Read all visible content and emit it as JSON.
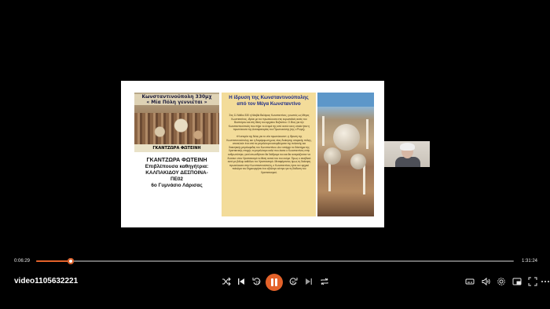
{
  "slide": {
    "thumbnail": {
      "title_line1": "Κωνσταντινούπολη 330μχ",
      "title_line2": "« Μία Πόλη γεννιέται »",
      "caption": "ΓΚΑΝΤΖΩΡΑ ΦΩΤΕΙΝΗ"
    },
    "author": {
      "name": "ΓΚΑΝΤΖΩΡΑ ΦΩΤΕΙΝΗ",
      "supervisor_label": "Επιβλέπουσα καθηγήτρια:",
      "supervisor_name": "ΚΑΛΠΑΚΙΔΟΥ ΔΕΣΠΟΙΝΑ-",
      "supervisor_code": "ΠΕ02",
      "school": "6ο Γυμνάσιο Λάρισας"
    },
    "article": {
      "title": "Η ίδρυση της Κωνσταντινούπολης από τον Μέγα Κωνσταντίνο",
      "paragraph1": "Στις 11 Μαΐου 330 η Νέαβία Βαλέριος Κωνσταντίνος, γνωστός ως Μέγας Κωνσταντίνος, ιδρύει με τον πρωτεύουσα στις ευρωπαϊκές ακτές του Βοσπόρου και στη θέση του αρχαίου Βυζαντίου. Ο ίδιος για την Κωνσταντινούπολη που πήρε το όνομά της από αυτόν και η οποία ήταν η πρωτεύουσα της Αυτοκρατορίας του Πρωτευούσης (της ν.Ρώμη).",
      "paragraph2": "«Η ιστορία της Νέας για το νέα πρωτεύουσα», η ίδρυση της Κωνσταντινούπολης και η διαμόρφωση μιας νέας διοίκησης ιστορικής πόλης, αποτελούν ένα από τα μεγαλύτερα κατορθώματα της πολιτικής και διοικητικής μεγαλοφυΐας του Κωνσταντίνου. Δεν υπάρχει το διάστημα της Χριστιανικής εποχής το μεγαλύτερο καλό που έκανε ο Κωνσταντίνος στην ανθρωπότητα, γιατί οπωσδήποτε θα διάδραμε του και θα αναγκάζονταν να δώσουν στον Χριστιανισμό το θέση αυτού του του ουόμε. Όμως ο αναβλικό αυτό με βάλομ καθόλου τον Χριστιανισμό. Μεταφέροντας όμως τη διοίκηση πρωτεύουσα στην Κωνσταντινούπολη, ο Κωνσταντίνος έγινε τον αρχικό ποίκιλμα του δημιουργήσει ένα αξιόλογο κέντρο για τη διάδοση του Χριστιανισμού."
    }
  },
  "player": {
    "current_time": "0:06:29",
    "total_time": "1:31:24",
    "progress_percent": 7.3,
    "video_title": "video1105632221",
    "accent_color": "#e3622a"
  },
  "controls": {
    "shuffle_icon": "shuffle-icon",
    "previous_icon": "previous-icon",
    "rewind_icon": "rewind-10-icon",
    "pause_icon": "pause-icon",
    "forward_icon": "forward-30-icon",
    "next_icon": "next-icon",
    "repeat_icon": "repeat-icon",
    "caption_icon": "subtitles-icon",
    "volume_icon": "volume-icon",
    "settings_icon": "settings-icon",
    "miniplayer_icon": "miniplayer-icon",
    "cast_icon": "cast-icon",
    "fullscreen_icon": "fullscreen-icon",
    "more_icon": "more-icon"
  }
}
